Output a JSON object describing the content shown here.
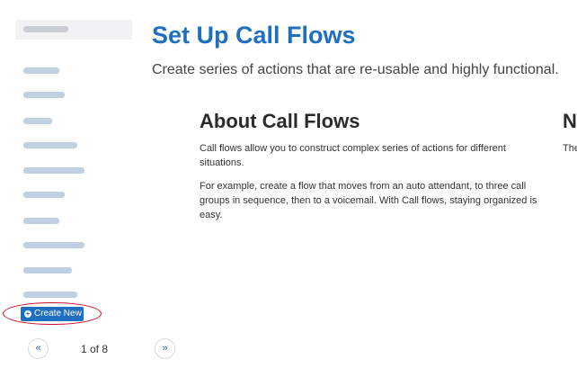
{
  "sidebar": {
    "create_label": "Create New",
    "pagination": {
      "prev": "«",
      "next": "»",
      "text": "1 of 8"
    }
  },
  "main": {
    "title": "Set Up Call Flows",
    "subtitle": "Create series of actions that are re-usable and highly functional.",
    "about": {
      "title": "About Call Flows",
      "p1": "Call flows allow you to construct complex series of actions for different situations.",
      "p2": "For example, create a flow that moves from an auto attendant, to three call groups in sequence, then to a voicemail. With Call flows, staying organized is easy."
    },
    "next": {
      "title": "N",
      "p1": "The day"
    }
  }
}
